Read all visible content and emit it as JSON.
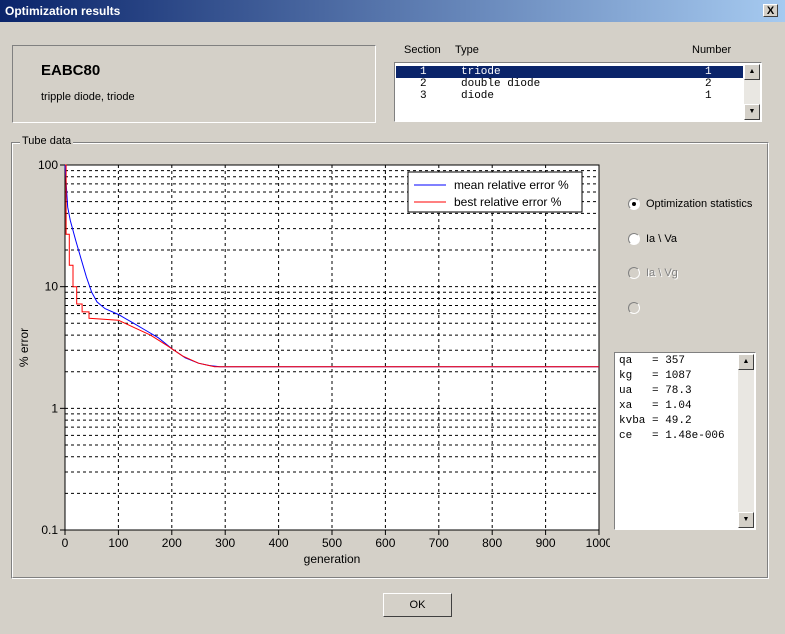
{
  "window": {
    "title": "Optimization results",
    "close_label": "X"
  },
  "tube": {
    "name": "EABC80",
    "description": "tripple diode, triode"
  },
  "sections": {
    "headers": {
      "section": "Section",
      "type": "Type",
      "number": "Number"
    },
    "rows": [
      {
        "section": "1",
        "type": "triode",
        "number": "1",
        "selected": true
      },
      {
        "section": "2",
        "type": "double diode",
        "number": "2",
        "selected": false
      },
      {
        "section": "3",
        "type": "diode",
        "number": "1",
        "selected": false
      }
    ]
  },
  "group_label": "Tube data",
  "radio_options": [
    {
      "label": "Optimization statistics",
      "checked": true,
      "disabled": false
    },
    {
      "label": "Ia \\ Va",
      "checked": false,
      "disabled": false
    },
    {
      "label": "Ia \\ Vg",
      "checked": false,
      "disabled": true
    },
    {
      "label": "",
      "checked": false,
      "disabled": true
    }
  ],
  "stats": [
    "qa   = 357",
    "kg   = 1087",
    "ua   = 78.3",
    "xa   = 1.04",
    "kvba = 49.2",
    "ce   = 1.48e-006"
  ],
  "ok_label": "OK",
  "chart_data": {
    "type": "line",
    "xlabel": "generation",
    "ylabel": "% error",
    "xlim": [
      0,
      1000
    ],
    "ylim": [
      0.1,
      100
    ],
    "yscale": "log",
    "grid": true,
    "legend_position": "top-right",
    "x_ticks": [
      "0",
      "100",
      "200",
      "300",
      "400",
      "500",
      "600",
      "700",
      "800",
      "900",
      "1000"
    ],
    "y_ticks": [
      "0.1",
      "1",
      "10",
      "100"
    ],
    "series": [
      {
        "name": "mean relative error %",
        "color": "#0000ff",
        "x": [
          0,
          5,
          10,
          20,
          30,
          40,
          50,
          60,
          75,
          100,
          125,
          150,
          175,
          200,
          225,
          250,
          270,
          290,
          1000
        ],
        "y": [
          100,
          45,
          35,
          24,
          17,
          12,
          9.0,
          7.5,
          6.6,
          5.9,
          5.1,
          4.4,
          3.8,
          3.1,
          2.6,
          2.35,
          2.25,
          2.2,
          2.2
        ]
      },
      {
        "name": "best relative error %",
        "color": "#ff0000",
        "x": [
          0,
          2,
          2,
          8,
          8,
          15,
          15,
          22,
          22,
          32,
          32,
          45,
          45,
          100,
          130,
          160,
          190,
          220,
          250,
          280,
          1000
        ],
        "y": [
          100,
          100,
          27,
          27,
          15,
          15,
          10,
          10,
          7.2,
          7.2,
          6.2,
          6.2,
          5.5,
          5.3,
          4.6,
          4.0,
          3.3,
          2.7,
          2.35,
          2.2,
          2.2
        ]
      }
    ]
  }
}
